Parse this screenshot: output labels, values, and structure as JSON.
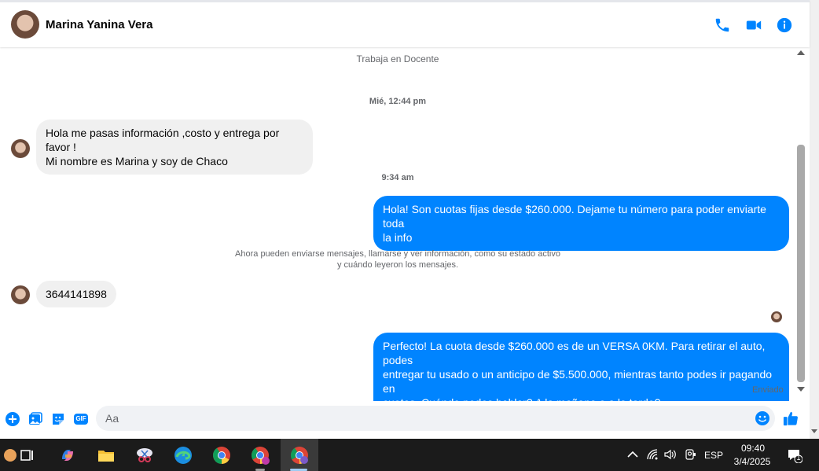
{
  "header": {
    "contact_name": "Marina Yanina Vera",
    "icons": [
      "phone-icon",
      "video-call-icon",
      "info-icon"
    ]
  },
  "conversation": {
    "profile_info": "Trabaja en Docente",
    "timestamp_1": "Mié, 12:44 pm",
    "msg_1_line1": "Hola me pasas información ,costo y entrega por favor !",
    "msg_1_line2": "Mi nombre es Marina y soy de Chaco",
    "timestamp_2": "9:34 am",
    "msg_2_line1": "Hola! Son cuotas fijas desde $260.000. Dejame tu número para poder enviarte toda",
    "msg_2_line2": "la info",
    "system_line1": "Ahora pueden enviarse mensajes, llamarse y ver información, como su estado activo",
    "system_line2": "y cuándo leyeron los mensajes.",
    "msg_3": "3644141898",
    "msg_4_line1": "Perfecto! La cuota desde $260.000 es de un VERSA 0KM. Para retirar el auto, podes",
    "msg_4_line2": "entregar tu usado o un anticipo de $5.500.000, mientras tanto podes ir pagando en",
    "msg_4_line3": "cuotas. Cuándo podes hablar? A la mañana o a la tarde?",
    "status": "Enviado"
  },
  "composer": {
    "placeholder": "Aa",
    "gif_label": "GIF"
  },
  "taskbar": {
    "language": "ESP",
    "time": "09:40",
    "date": "3/4/2025",
    "notification_count": "1"
  },
  "colors": {
    "accent": "#0084ff",
    "incoming_bubble": "#f0f0f0",
    "taskbar": "#1b1b1b"
  }
}
